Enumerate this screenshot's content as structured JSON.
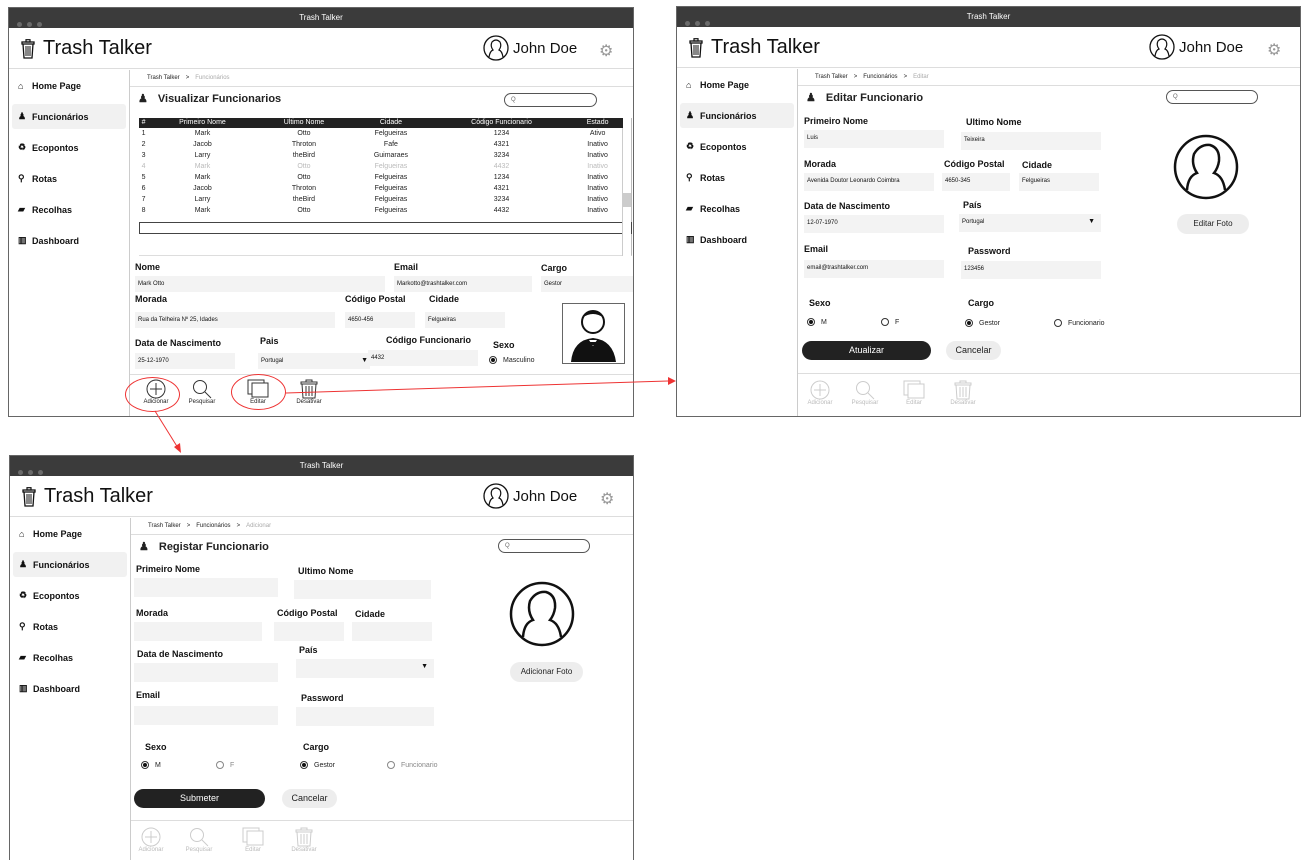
{
  "window_title": "Trash Talker",
  "app_name": "Trash Talker",
  "user_name": "John Doe",
  "nav": [
    "Home Page",
    "Funcionários",
    "Ecopontos",
    "Rotas",
    "Recolhas",
    "Dashboard"
  ],
  "crumb_sep": ">",
  "tools": {
    "add": "Adicionar",
    "search": "Pesquisar",
    "edit": "Editar",
    "disable": "Desativar"
  },
  "view": {
    "crumb": [
      "Trash Talker",
      "Funcionários"
    ],
    "title": "Visualizar Funcionarios",
    "search_placeholder": "Q",
    "columns": [
      "#",
      "Primeiro Nome",
      "Ultimo Nome",
      "Cidade",
      "Código Funcionario",
      "Estado"
    ],
    "rows": [
      [
        "1",
        "Mark",
        "Otto",
        "Felgueiras",
        "1234",
        "Ativo"
      ],
      [
        "2",
        "Jacob",
        "Throton",
        "Fafe",
        "4321",
        "Inativo"
      ],
      [
        "3",
        "Larry",
        "theBird",
        "Guimaraes",
        "3234",
        "Inativo"
      ],
      [
        "4",
        "Mark",
        "Otto",
        "Felgueiras",
        "4432",
        "Inativo"
      ],
      [
        "5",
        "Mark",
        "Otto",
        "Felgueiras",
        "1234",
        "Inativo"
      ],
      [
        "6",
        "Jacob",
        "Throton",
        "Felgueiras",
        "4321",
        "Inativo"
      ],
      [
        "7",
        "Larry",
        "theBird",
        "Felgueiras",
        "3234",
        "Inativo"
      ],
      [
        "8",
        "Mark",
        "Otto",
        "Felgueiras",
        "4432",
        "Inativo"
      ]
    ],
    "detail": {
      "nome_label": "Nome",
      "nome": "Mark Otto",
      "email_label": "Email",
      "email": "Markotto@trashtalker.com",
      "cargo_label": "Cargo",
      "cargo": "Gestor",
      "morada_label": "Morada",
      "morada": "Rua da Telheira Nº 25, Idades",
      "cp_label": "Código Postal",
      "cp": "4650-456",
      "cidade_label": "Cidade",
      "cidade": "Felgueiras",
      "dn_label": "Data de Nascimento",
      "dn": "25-12-1970",
      "pais_label": "Pais",
      "pais": "Portugal",
      "codigo_label": "Código Funcionario",
      "codigo": "4432",
      "sexo_label": "Sexo",
      "sexo": "Masculino"
    }
  },
  "edit": {
    "crumb": [
      "Trash Talker",
      "Funcionários",
      "Editar"
    ],
    "title": "Editar Funcionario",
    "primeiro_label": "Primeiro Nome",
    "primeiro": "Luis",
    "ultimo_label": "Ultimo Nome",
    "ultimo": "Teixeira",
    "morada_label": "Morada",
    "morada": "Avenida Doutor Leonardo Coimbra",
    "cp_label": "Código Postal",
    "cp": "4650-345",
    "cidade_label": "Cidade",
    "cidade": "Felgueiras",
    "dn_label": "Data de Nascimento",
    "dn": "12-07-1970",
    "pais_label": "País",
    "pais": "Portugal",
    "email_label": "Email",
    "email": "email@trashtalker.com",
    "password_label": "Password",
    "password": "123456",
    "sexo_label": "Sexo",
    "sexo_m": "M",
    "sexo_f": "F",
    "cargo_label": "Cargo",
    "cargo_gestor": "Gestor",
    "cargo_func": "Funcionario",
    "submit": "Atualizar",
    "cancel": "Cancelar",
    "photo": "Editar Foto"
  },
  "create": {
    "crumb": [
      "Trash Talker",
      "Funcionários",
      "Adicionar"
    ],
    "title": "Registar Funcionario",
    "primeiro_label": "Primeiro Nome",
    "ultimo_label": "Ultimo Nome",
    "morada_label": "Morada",
    "cp_label": "Código Postal",
    "cidade_label": "Cidade",
    "dn_label": "Data de Nascimento",
    "pais_label": "País",
    "email_label": "Email",
    "password_label": "Password",
    "sexo_label": "Sexo",
    "sexo_m": "M",
    "sexo_f": "F",
    "cargo_label": "Cargo",
    "cargo_gestor": "Gestor",
    "cargo_func": "Funcionario",
    "submit": "Submeter",
    "cancel": "Cancelar",
    "photo": "Adicionar Foto"
  },
  "colors": {
    "titlebar": "#3b3b3b",
    "header": "#222222",
    "annotation": "#e33333"
  }
}
